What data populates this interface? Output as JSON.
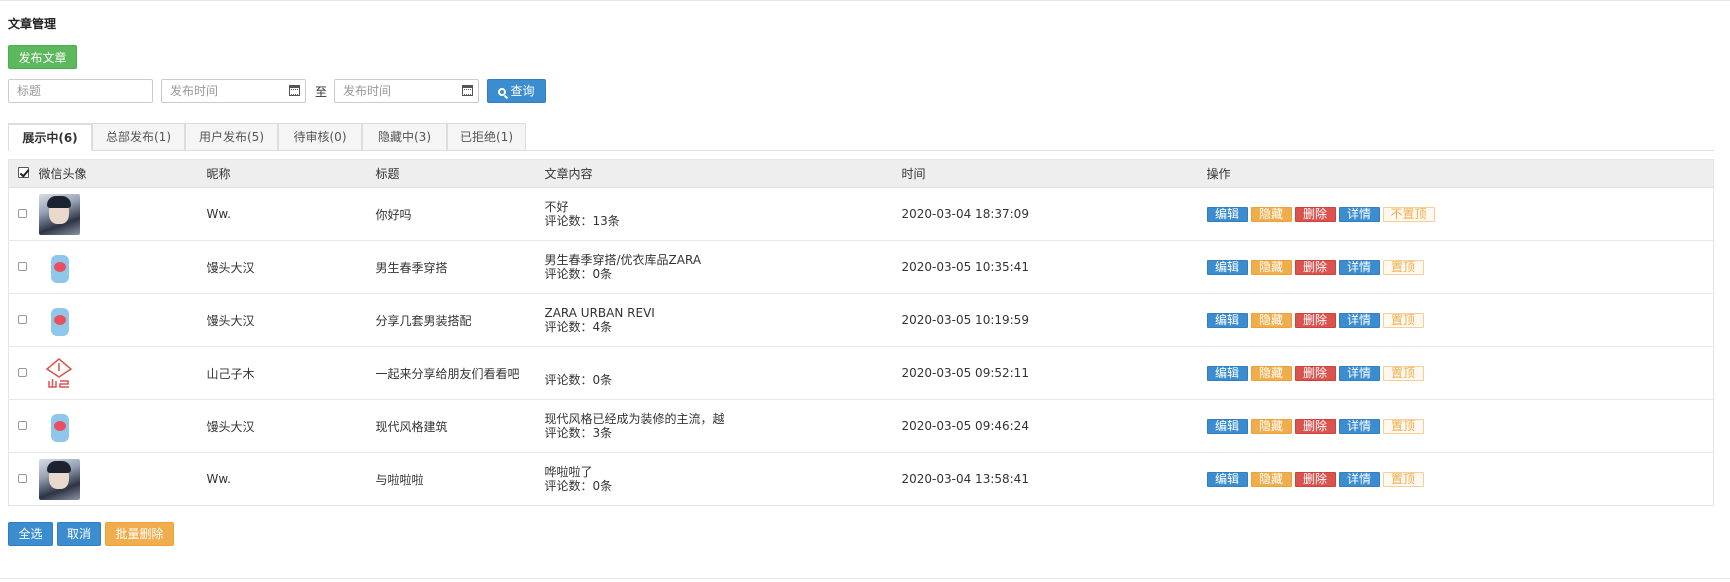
{
  "page": {
    "title": "文章管理"
  },
  "toolbar": {
    "publish_label": "发布文章"
  },
  "filters": {
    "title_placeholder": "标题",
    "start_placeholder": "发布时间",
    "to_label": "至",
    "end_placeholder": "发布时间",
    "query_label": "查询"
  },
  "tabs": [
    {
      "label": "展示中(6)",
      "active": true
    },
    {
      "label": "总部发布(1)",
      "active": false
    },
    {
      "label": "用户发布(5)",
      "active": false
    },
    {
      "label": "待审核(0)",
      "active": false
    },
    {
      "label": "隐藏中(3)",
      "active": false
    },
    {
      "label": "已拒绝(1)",
      "active": false
    }
  ],
  "table": {
    "headers": {
      "avatar": "微信头像",
      "nickname": "昵称",
      "title": "标题",
      "content": "文章内容",
      "time": "时间",
      "ops": "操作"
    },
    "rows": [
      {
        "avatar": "photo-avatar",
        "nickname": "Ww.",
        "title": "你好吗",
        "content": "不好",
        "comments": "评论数：13条",
        "time": "2020-03-04 18:37:09",
        "top_label": "不置顶"
      },
      {
        "avatar": "bottle-avatar",
        "nickname": "馒头大汉",
        "title": "男生春季穿搭",
        "content": "男生春季穿搭/优衣库品ZARA",
        "comments": "评论数：0条",
        "time": "2020-03-05 10:35:41",
        "top_label": "置顶"
      },
      {
        "avatar": "bottle-avatar",
        "nickname": "馒头大汉",
        "title": "分享几套男装搭配",
        "content": "ZARA URBAN REVI",
        "comments": "评论数：4条",
        "time": "2020-03-05 10:19:59",
        "top_label": "置顶"
      },
      {
        "avatar": "logo-avatar",
        "nickname": "山己子木",
        "title": "一起来分享给朋友们看看吧",
        "content": "",
        "comments": "评论数：0条",
        "time": "2020-03-05 09:52:11",
        "top_label": "置顶"
      },
      {
        "avatar": "bottle-avatar",
        "nickname": "馒头大汉",
        "title": "现代风格建筑",
        "content": "现代风格已经成为装修的主流，越",
        "comments": "评论数：3条",
        "time": "2020-03-05 09:46:24",
        "top_label": "置顶"
      },
      {
        "avatar": "photo-avatar",
        "nickname": "Ww.",
        "title": "与啦啦啦",
        "content": "哗啦啦了",
        "comments": "评论数：0条",
        "time": "2020-03-04 13:58:41",
        "top_label": "置顶"
      }
    ],
    "ops": {
      "edit": "编辑",
      "hide": "隐藏",
      "delete": "删除",
      "detail": "详情"
    }
  },
  "footer": {
    "select_all": "全选",
    "cancel": "取消",
    "batch_delete": "批量删除"
  },
  "colors": {
    "primary": "#3c8dcf",
    "success": "#5cb85c",
    "warning": "#f0ad4e",
    "danger": "#d9534f"
  }
}
